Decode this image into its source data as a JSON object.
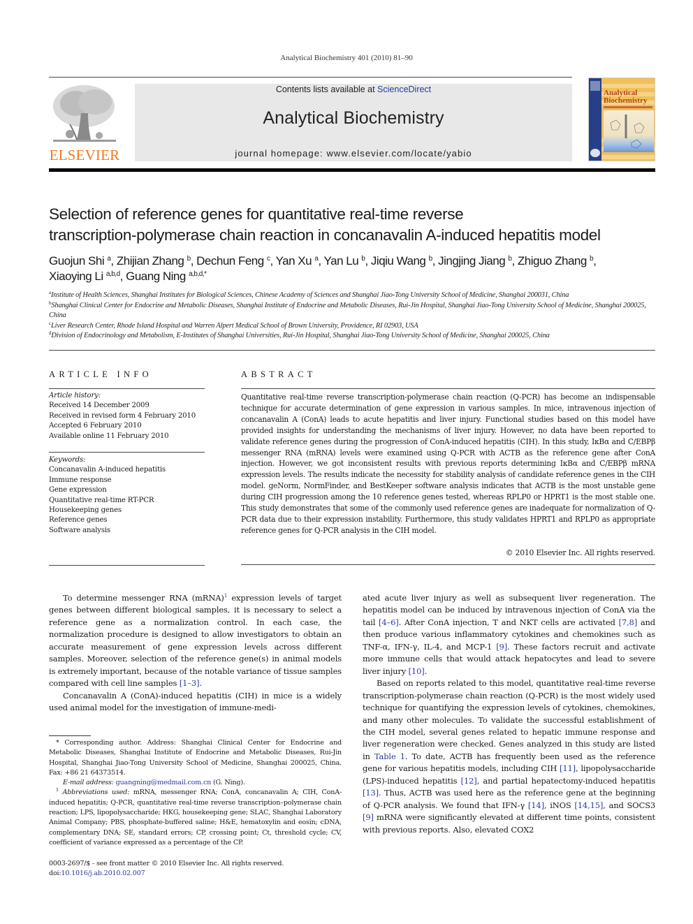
{
  "running_head": "Analytical Biochemistry 401 (2010) 81–90",
  "header": {
    "publisher_logo_text": "ELSEVIER",
    "contents_prefix": "Contents lists available at ",
    "contents_link": "ScienceDirect",
    "journal_title": "Analytical Biochemistry",
    "homepage_line": "journal homepage: www.elsevier.com/locate/yabio",
    "cover": {
      "title_line1": "Analytical",
      "title_line2": "Biochemistry"
    }
  },
  "colors": {
    "publisher_orange": "#f07a1c",
    "link_blue": "#2a3a9a",
    "header_gray": "#e8e8e8",
    "cover_blue": "#263f86",
    "cover_gold": "#f1c05a"
  },
  "article": {
    "title_line1": "Selection of reference genes for quantitative real-time reverse",
    "title_line2": "transcription-polymerase chain reaction in concanavalin A-induced hepatitis model",
    "authors": [
      {
        "name": "Guojun Shi",
        "aff": "a",
        "sep": ", "
      },
      {
        "name": "Zhijian Zhang",
        "aff": "b",
        "sep": ", "
      },
      {
        "name": "Dechun Feng",
        "aff": "c",
        "sep": ", "
      },
      {
        "name": "Yan Xu",
        "aff": "a",
        "sep": ", "
      },
      {
        "name": "Yan Lu",
        "aff": "b",
        "sep": ", "
      },
      {
        "name": "Jiqiu Wang",
        "aff": "b",
        "sep": ", "
      },
      {
        "name": "Jingjing Jiang",
        "aff": "b",
        "sep": ", "
      },
      {
        "name": "Zhiguo Zhang",
        "aff": "b",
        "sep": ","
      },
      {
        "name": "Xiaoying Li",
        "aff": "a,b,d",
        "sep": ", "
      },
      {
        "name": "Guang Ning",
        "aff": "a,b,d,*",
        "sep": ""
      }
    ],
    "affiliations": [
      {
        "key": "a",
        "text": "Institute of Health Sciences, Shanghai Institutes for Biological Sciences, Chinese Academy of Sciences and Shanghai Jiao-Tong University School of Medicine, Shanghai 200031, China"
      },
      {
        "key": "b",
        "text": "Shanghai Clinical Center for Endocrine and Metabolic Diseases, Shanghai Institute of Endocrine and Metabolic Diseases, Rui-Jin Hospital, Shanghai Jiao-Tong University School of Medicine, Shanghai 200025, China"
      },
      {
        "key": "c",
        "text": "Liver Research Center, Rhode Island Hospital and Warren Alpert Medical School of Brown University, Providence, RI 02903, USA"
      },
      {
        "key": "d",
        "text": "Division of Endocrinology and Metabolism, E-Institutes of Shanghai Universities, Rui-Jin Hospital, Shanghai Jiao-Tong University School of Medicine, Shanghai 200025, China"
      }
    ]
  },
  "article_info": {
    "heading": "ARTICLE INFO",
    "history_label": "Article history:",
    "history": [
      "Received 14 December 2009",
      "Received in revised form 4 February 2010",
      "Accepted 6 February 2010",
      "Available online 11 February 2010"
    ],
    "keywords_label": "Keywords:",
    "keywords": [
      "Concanavalin A-induced hepatitis",
      "Immune response",
      "Gene expression",
      "Quantitative real-time RT-PCR",
      "Housekeeping genes",
      "Reference genes",
      "Software analysis"
    ]
  },
  "abstract": {
    "heading": "ABSTRACT",
    "text": "Quantitative real-time reverse transcription-polymerase chain reaction (Q-PCR) has become an indispensable technique for accurate determination of gene expression in various samples. In mice, intravenous injection of concanavalin A (ConA) leads to acute hepatitis and liver injury. Functional studies based on this model have provided insights for understanding the mechanisms of liver injury. However, no data have been reported to validate reference genes during the progression of ConA-induced hepatitis (CIH). In this study, IκBα and C/EBPβ messenger RNA (mRNA) levels were examined using Q-PCR with ACTB as the reference gene after ConA injection. However, we got inconsistent results with previous reports determining IκBα and C/EBPβ mRNA expression levels. The results indicate the necessity for stability analysis of candidate reference genes in the CIH model. geNorm, NormFinder, and BestKeeper software analysis indicates that ACTB is the most unstable gene during CIH progression among the 10 reference genes tested, whereas RPLP0 or HPRT1 is the most stable one. This study demonstrates that some of the commonly used reference genes are inadequate for normalization of Q-PCR data due to their expression instability. Furthermore, this study validates HPRT1 and RPLP0 as appropriate reference genes for Q-PCR analysis in the CIH model.",
    "copyright": "© 2010 Elsevier Inc. All rights reserved."
  },
  "body": {
    "left": {
      "p1_a": "To determine messenger RNA (mRNA)",
      "p1_fn": "1",
      "p1_b": " expression levels of target genes between different biological samples, it is necessary to select a reference gene as a normalization control. In each case, the normalization procedure is designed to allow investigators to obtain an accurate measurement of gene expression levels across different samples. Moreover, selection of the reference gene(s) in animal models is extremely important, because of the notable variance of tissue samples compared with cell line samples ",
      "p1_ref": "[1–3]",
      "p1_end": ".",
      "p2": "Concanavalin A (ConA)-induced hepatitis (CIH) in mice is a widely used animal model for the investigation of immune-medi-"
    },
    "right": {
      "p1_a": "ated acute liver injury as well as subsequent liver regeneration. The hepatitis model can be induced by intravenous injection of ConA via the tail ",
      "ref_4_6": "[4–6]",
      "p1_b": ". After ConA injection, T and NKT cells are activated ",
      "ref_7_8": "[7,8]",
      "p1_c": " and then produce various inflammatory cytokines and chemokines such as TNF-α, IFN-γ, IL-4, and MCP-1 ",
      "ref_9": "[9]",
      "p1_d": ". These factors recruit and activate more immune cells that would attack hepatocytes and lead to severe liver injury ",
      "ref_10": "[10]",
      "p1_e": ".",
      "p2_a": "Based on reports related to this model, quantitative real-time reverse transcription-polymerase chain reaction (Q-PCR) is the most widely used technique for quantifying the expression levels of cytokines, chemokines, and many other molecules. To validate the successful establishment of the CIH model, several genes related to hepatic immune response and liver regeneration were checked. Genes analyzed in this study are listed in ",
      "table_ref": "Table 1",
      "p2_b": ". To date, ACTB has frequently been used as the reference gene for various hepatitis models, including CIH ",
      "ref_11": "[11]",
      "p2_c": ", lipopolysaccharide (LPS)-induced hepatitis ",
      "ref_12": "[12]",
      "p2_d": ", and partial hepatectomy-induced hepatitis ",
      "ref_13": "[13]",
      "p2_e": ". Thus, ACTB was used here as the reference gene at the beginning of Q-PCR analysis. We found that IFN-γ ",
      "ref_14": "[14]",
      "p2_f": ", iNOS ",
      "ref_14_15": "[14,15]",
      "p2_g": ", and SOCS3 ",
      "ref_9b": "[9]",
      "p2_h": " mRNA were significantly elevated at different time points, consistent with previous reports. Also, elevated COX2"
    }
  },
  "footnotes": {
    "corresponding_mark": "*",
    "corresponding": " Corresponding author. Address: Shanghai Clinical Center for Endocrine and Metabolic Diseases, Shanghai Institute of Endocrine and Metabolic Diseases, Rui-Jin Hospital, Shanghai Jiao-Tong University School of Medicine, Shanghai 200025, China. Fax: +86 21 64373514.",
    "email_label": "E-mail address:",
    "email": "guangning@medmail.com.cn",
    "email_owner": " (G. Ning).",
    "abbrev_mark": "1",
    "abbrev_label": "Abbreviations used:",
    "abbrev_text": " mRNA, messenger RNA; ConA, concanavalin A; CIH, ConA-induced hepatitis; Q-PCR, quantitative real-time reverse transcription–polymerase chain reaction; LPS, lipopolysaccharide; HKG, housekeeping gene; SLAC, Shanghai Laboratory Animal Company; PBS, phosphate-buffered saline; H&E, hematoxylin and eosin; cDNA, complementary DNA; SE, standard errors; CP, crossing point; Ct, threshold cycle; CV, coefficient of variance expressed as a percentage of the CP."
  },
  "front_matter": {
    "issn_line": "0003-2697/$ - see front matter © 2010 Elsevier Inc. All rights reserved.",
    "doi_prefix": "doi:",
    "doi": "10.1016/j.ab.2010.02.007"
  }
}
